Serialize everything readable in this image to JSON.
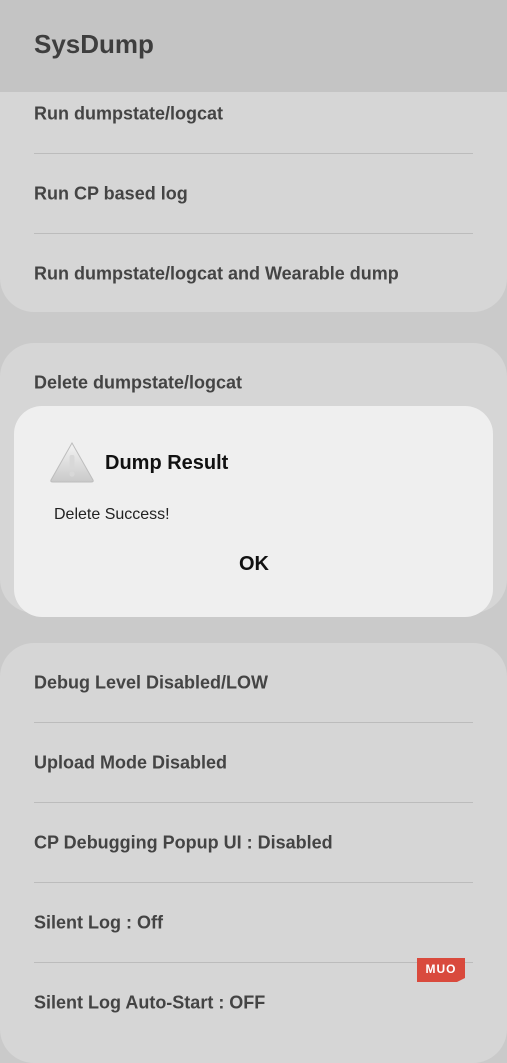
{
  "app": {
    "title": "SysDump"
  },
  "group1": [
    {
      "label": "Run dumpstate/logcat"
    },
    {
      "label": "Run CP based log"
    },
    {
      "label": "Run dumpstate/logcat and Wearable dump"
    }
  ],
  "group2": [
    {
      "label": "Delete dumpstate/logcat"
    }
  ],
  "group3": [
    {
      "label": "Debug Level Disabled/LOW"
    },
    {
      "label": "Upload Mode Disabled"
    },
    {
      "label": "CP Debugging Popup UI : Disabled"
    },
    {
      "label": "Silent Log : Off"
    },
    {
      "label": "Silent Log Auto-Start : OFF"
    }
  ],
  "dialog": {
    "title": "Dump Result",
    "message": "Delete Success!",
    "ok_label": "OK",
    "icon": "warning-icon"
  },
  "watermark": {
    "text": "MUO",
    "color": "#d94a3d"
  },
  "colors": {
    "background_dimmed": "#cacaca",
    "card": "#d6d6d6",
    "dialog": "#efefef"
  }
}
